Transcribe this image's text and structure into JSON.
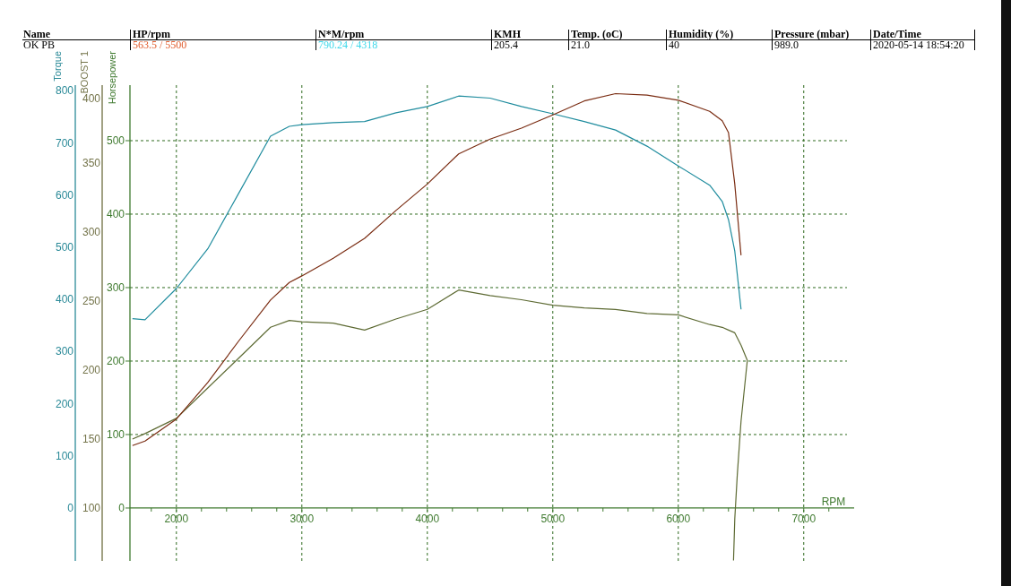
{
  "results_table": {
    "columns": [
      "Name",
      "HP/rpm",
      "N*M/rpm",
      "KMH",
      "Temp. (oC)",
      "Humidity (%)",
      "Pressure (mbar)",
      "Date/Time"
    ],
    "rows": [
      {
        "cells": [
          {
            "text": "OK PB"
          },
          {
            "text": "563.5 / 5500",
            "color": "#e05a2a"
          },
          {
            "text": "790.24 / 4318",
            "color": "#3cd8ea"
          },
          {
            "text": "205.4"
          },
          {
            "text": "21.0"
          },
          {
            "text": "40"
          },
          {
            "text": "989.0"
          },
          {
            "text": "2020-05-14 18:54:20"
          }
        ]
      }
    ]
  },
  "dyno_chart": {
    "chart_data": {
      "type": "line",
      "grid": true,
      "xlabel": "RPM",
      "xlim": [
        1630,
        7366
      ],
      "xticks": [
        2000,
        3000,
        4000,
        5000,
        6000,
        7000
      ],
      "ylabel": "Horsepower",
      "ylim": [
        -72,
        575.6
      ],
      "yticks": [
        0,
        100,
        200,
        300,
        400,
        500
      ],
      "y2label": "Torque",
      "y2lim": [
        -101.4,
        811
      ],
      "y2ticks": [
        0,
        100,
        200,
        300,
        400,
        500,
        600,
        700,
        800
      ],
      "y3label": "BOOST 1",
      "y3lim": [
        61.7,
        406.5
      ],
      "y3ticks": [
        100,
        150,
        200,
        250,
        300,
        350,
        400
      ],
      "x": [
        1650,
        1750,
        2000,
        2250,
        2500,
        2750,
        2900,
        3000,
        3250,
        3500,
        3750,
        4000,
        4250,
        4500,
        4750,
        5000,
        5250,
        5500,
        5750,
        6000,
        6250,
        6350,
        6400,
        6450,
        6500,
        6550,
        6500,
        6470,
        6450,
        6440
      ],
      "series": [
        {
          "axis": "y2",
          "color": "#1f8c9e",
          "values": [
            363,
            361,
            421,
            497,
            605,
            713,
            732,
            735,
            739,
            741,
            758,
            770,
            790,
            786,
            770,
            756,
            741,
            725,
            694,
            656,
            619,
            588,
            553,
            493,
            381,
            null,
            null,
            null,
            null,
            null
          ]
        },
        {
          "axis": "y3",
          "color": "#5e6b34",
          "values": [
            150,
            154,
            165,
            187,
            209,
            231,
            236,
            235,
            234,
            229,
            237,
            244,
            258,
            254,
            251,
            247,
            245,
            244,
            241,
            240,
            233,
            231,
            229,
            227,
            218,
            207,
            163,
            124,
            92,
            62
          ]
        },
        {
          "color": "#7a2c12",
          "values": [
            85,
            91,
            121,
            171,
            228,
            283,
            307,
            316,
            340,
            367,
            405,
            441,
            482,
            502,
            517,
            535,
            554,
            564,
            562,
            555,
            540,
            527,
            511,
            441,
            344,
            null,
            null,
            null,
            null,
            null
          ]
        }
      ]
    }
  }
}
